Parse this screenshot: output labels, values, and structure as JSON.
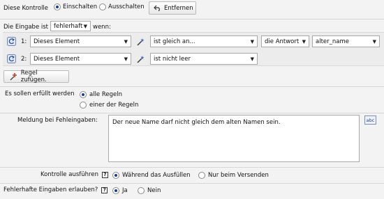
{
  "top": {
    "label": "Diese Kontrolle",
    "option_on": "Einschalten",
    "option_off": "Ausschalten",
    "remove_button": "Entfernen"
  },
  "condition": {
    "prefix": "Die Eingabe ist",
    "state_value": "fehlerhaft",
    "suffix": "wenn:"
  },
  "rules": [
    {
      "number": "1:",
      "element": "Dieses Element",
      "operator": "ist gleich an...",
      "source": "die Antwort",
      "value": "alter_name"
    },
    {
      "number": "2:",
      "element": "Dieses Element",
      "operator": "ist nicht leer"
    }
  ],
  "add_rule_button": "Regel zufügen.",
  "fulfillment": {
    "label": "Es sollen erfüllt werden",
    "option_all": "alle Regeln",
    "option_one": "einer der Regeln"
  },
  "message": {
    "label": "Meldung bei Fehleingaben:",
    "text": "Der neue Name darf nicht gleich dem alten Namen sein.",
    "spell_icon_text": "abc"
  },
  "run_check": {
    "label": "Kontrolle ausführen",
    "help": "?",
    "option_during": "Während das Ausfüllen",
    "option_submit": "Nur beim Versenden"
  },
  "allow_invalid": {
    "label": "Fehlerhafte Eingaben erlauben?",
    "help": "?",
    "option_yes": "Ja",
    "option_no": "Nein"
  },
  "colors": {
    "background": "#f3f3f3",
    "panel": "#e9e9e9",
    "radio_selected": "#1a3a9a"
  },
  "icons": [
    "undo-icon",
    "refresh-icon",
    "wand-icon",
    "add-rule-icon",
    "spellcheck-icon",
    "help-icon",
    "chevron-down-icon"
  ]
}
